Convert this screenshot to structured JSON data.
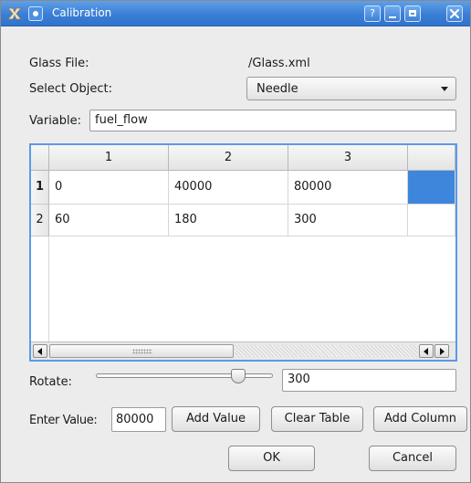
{
  "window": {
    "title": "Calibration"
  },
  "titlebar": {
    "help": "?"
  },
  "form": {
    "glass_file_label": "Glass File:",
    "glass_file_value": "/Glass.xml",
    "select_object_label": "Select Object:",
    "select_object_value": "Needle",
    "variable_label": "Variable:",
    "variable_value": "fuel_flow"
  },
  "table": {
    "columns": [
      "1",
      "2",
      "3"
    ],
    "rows": [
      {
        "header": "1",
        "cells": [
          "0",
          "40000",
          "80000"
        ]
      },
      {
        "header": "2",
        "cells": [
          "60",
          "180",
          "300"
        ]
      }
    ],
    "selected_cell": {
      "row": 1,
      "column": 4
    }
  },
  "rotate": {
    "label": "Rotate:",
    "value": "300",
    "slider_fraction": 0.8
  },
  "enter_value": {
    "label": "Enter Value:",
    "value": "80000"
  },
  "buttons": {
    "add_value": "Add Value",
    "clear_table": "Clear Table",
    "add_column": "Add Column",
    "ok": "OK",
    "cancel": "Cancel"
  },
  "colors": {
    "titlebar": "#3a7fd6",
    "selection": "#3d86dc"
  }
}
